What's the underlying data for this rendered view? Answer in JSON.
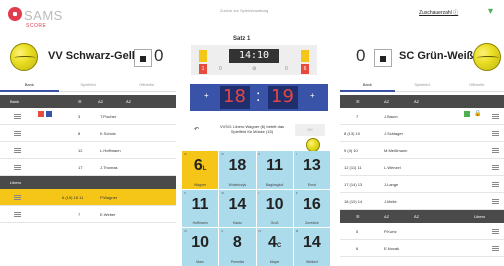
{
  "app": {
    "logo_text": "SAMS",
    "logo_sub": "SCORE",
    "back_link": "Zurück zur Spielverwaltung",
    "spectator_label": "Zuschauerzahl ⓘ"
  },
  "team_left": {
    "name": "VV Schwarz-Gelb",
    "sets": "0"
  },
  "team_right": {
    "name": "SC Grün-Weiß",
    "sets": "0"
  },
  "set": {
    "title": "Satz 1",
    "clock": "14:10",
    "timeouts_left": "0",
    "timeouts_right": "0",
    "mid_count": "0",
    "subs_left": "1",
    "subs_right": "6"
  },
  "score": {
    "left": "18",
    "right": "19",
    "plus": "+"
  },
  "tabs_left": [
    "Bank",
    "Spielfeld",
    "Offizielle"
  ],
  "tabs_right": [
    "Bank",
    "Spielfeld",
    "Offizielle"
  ],
  "roster_left": {
    "header": {
      "c1": "Bank",
      "c2": "☰",
      "c3": "AZ",
      "c4": "ÄZ"
    },
    "rows": [
      {
        "num": "3",
        "name": "T.Fischer"
      },
      {
        "num": "8",
        "name": "K.Schulz"
      },
      {
        "num": "12",
        "name": "L.Hoffmann"
      },
      {
        "num": "17",
        "name": "J.Thomas"
      }
    ],
    "libero_header": "Libero",
    "libero_rows": [
      {
        "num": "6 (15) 18 11",
        "name": "P.Wagner"
      },
      {
        "num": "7",
        "name": "E.Weber"
      }
    ]
  },
  "roster_right": {
    "header": {
      "c1": "☰",
      "c2": "AZ",
      "c3": "ÄZ"
    },
    "rows": [
      {
        "num": "7",
        "name": "J.Baum"
      },
      {
        "num": "8 (13) 10",
        "name": "J.Schlager"
      },
      {
        "num": "9 (4) 10",
        "name": "M.Meißmann"
      },
      {
        "num": "12 (11) 11",
        "name": "L.Wenzel"
      },
      {
        "num": "17 (14) 13",
        "name": "J.Lange"
      },
      {
        "num": "18 (10) 14",
        "name": "J.Meile"
      }
    ],
    "libero_header": "Libero",
    "libero_rows": [
      {
        "num": "5",
        "name": "P.Kurtz"
      },
      {
        "num": "6",
        "name": "E.Novak"
      }
    ]
  },
  "message": {
    "undo": "↶",
    "text": "VVSG: Libero Wagner (6) betritt das Spielfeld für Mücke (15)",
    "ok": "OK"
  },
  "court": [
    {
      "pos": "IV",
      "num": "6",
      "sup": "L",
      "name": "Wagner",
      "server": true
    },
    {
      "pos": "III",
      "num": "18",
      "sup": "",
      "name": "Winkelczyk",
      "server": false
    },
    {
      "pos": "II",
      "num": "11",
      "sup": "",
      "name": "Baginsgkof",
      "server": false
    },
    {
      "pos": "I",
      "num": "13",
      "sup": "",
      "name": "Ernst",
      "server": false
    },
    {
      "pos": "V",
      "num": "11",
      "sup": "",
      "name": "Hoffmann",
      "server": false
    },
    {
      "pos": "VI",
      "num": "14",
      "sup": "",
      "name": "Kautz",
      "server": false
    },
    {
      "pos": "I",
      "num": "10",
      "sup": "",
      "name": "Groß",
      "server": false
    },
    {
      "pos": "II",
      "num": "16",
      "sup": "",
      "name": "Zuredick",
      "server": false
    },
    {
      "pos": "VI",
      "num": "10",
      "sup": "",
      "name": "Marx",
      "server": false
    },
    {
      "pos": "V",
      "num": "8",
      "sup": "",
      "name": "Pernetta",
      "server": false
    },
    {
      "pos": "IV",
      "num": "4",
      "sup": "C",
      "name": "Mayer",
      "server": false
    },
    {
      "pos": "III",
      "num": "14",
      "sup": "",
      "name": "Weikert",
      "server": false
    }
  ]
}
